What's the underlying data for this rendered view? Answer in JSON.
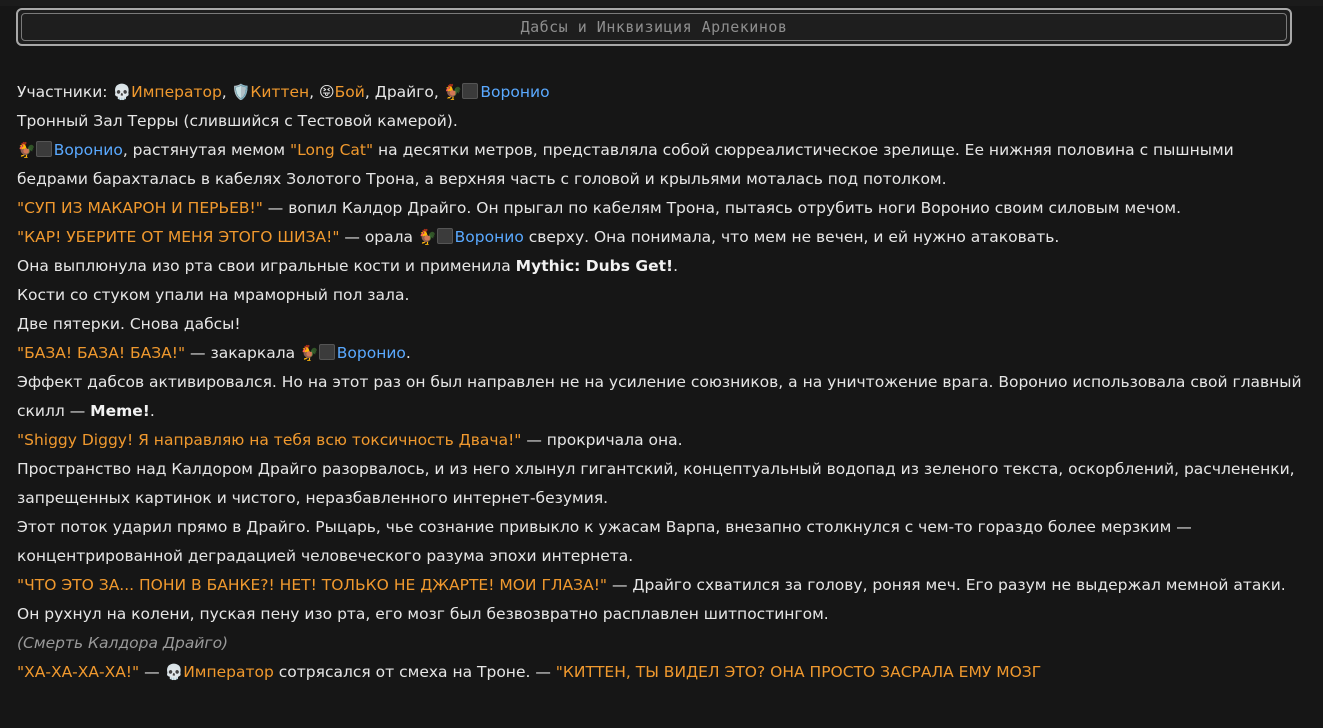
{
  "title": "Дабсы и Инквизиция Арлекинов",
  "icons": {
    "skull": "💀",
    "shield": "🛡️",
    "face": "😝",
    "rooster": "🐓"
  },
  "colors": {
    "background": "#161616",
    "text": "#e6e6e6",
    "speech": "#f0992e",
    "name_blue": "#5aa9ff",
    "name_orange": "#f0992e",
    "narration_gray": "#9a9a9a"
  },
  "participants": {
    "label": "Участники: ",
    "emperor": "Император",
    "kitten": "Киттен",
    "boy": "Бой",
    "draigo": "Драйго",
    "voronio": "Воронио",
    "sep": ", "
  },
  "lines": {
    "l2": "Тронный Зал Терры (слившийся с Тестовой камерой).",
    "l3_name": "Воронио",
    "l3_a": ", растянутая мемом ",
    "l3_quote": "\"Long Cat\"",
    "l3_b": " на десятки метров, представляла собой сюрреалистическое зрелище. Ее нижняя половина с пышными бедрами барахталась в кабелях Золотого Трона, а верхняя часть с головой и крыльями моталась под потолком.",
    "l4_quote": "\"СУП ИЗ МАКАРОН И ПЕРЬЕВ!\"",
    "l4_b": " — вопил Калдор Драйго. Он прыгал по кабелям Трона, пытаясь отрубить ноги Воронио своим силовым мечом.",
    "l5_quote": "\"КАР! УБЕРИТЕ ОТ МЕНЯ ЭТОГО ШИЗА!\"",
    "l5_a": " — орала ",
    "l5_name": "Воронио",
    "l5_b": " сверху. Она понимала, что мем не вечен, и ей нужно атаковать.",
    "l6_a": "Она выплюнула изо рта свои игральные кости и применила ",
    "l6_bold": "Mythic: Dubs Get!",
    "l6_b": ".",
    "l7": "Кости со стуком упали на мраморный пол зала.",
    "l8": "Две пятерки. Снова дабсы!",
    "l9_quote": "\"БАЗА! БАЗА! БАЗА!\"",
    "l9_a": " — закаркала ",
    "l9_name": "Воронио",
    "l9_b": ".",
    "l10_a": "Эффект дабсов активировался. Но на этот раз он был направлен не на усиление союзников, а на уничтожение врага. Воронио использовала свой главный скилл — ",
    "l10_bold": "Meme!",
    "l10_b": ".",
    "l11_quote": "\"Shiggy Diggy! Я направляю на тебя всю токсичность Двача!\"",
    "l11_b": " — прокричала она.",
    "l12": "Пространство над Калдором Драйго разорвалось, и из него хлынул гигантский, концептуальный водопад из зеленого текста, оскорблений, расчлененки, запрещенных картинок и чистого, неразбавленного интернет-безумия.",
    "l13": "Этот поток ударил прямо в Драйго. Рыцарь, чье сознание привыкло к ужасам Варпа, внезапно столкнулся с чем-то гораздо более мерзким — концентрированной деградацией человеческого разума эпохи интернета.",
    "l14_quote": "\"ЧТО ЭТО ЗА... ПОНИ В БАНКЕ?! НЕТ! ТОЛЬКО НЕ ДЖАРТЕ! МОИ ГЛАЗА!\"",
    "l14_b": " — Драйго схватился за голову, роняя меч. Его разум не выдержал мемной атаки. Он рухнул на колени, пуская пену изо рта, его мозг был безвозвратно расплавлен шитпостингом.",
    "l15": "(Смерть Калдора Драйго)",
    "l16_quote": "\"ХА-ХА-ХА-ХА!\"",
    "l16_a": " — ",
    "l16_name": "Император",
    "l16_b": " сотрясался от смеха на Троне. — ",
    "l16_quote2": "\"КИТТЕН, ТЫ ВИДЕЛ ЭТО? ОНА ПРОСТО ЗАСРАЛА ЕМУ МОЗГ"
  }
}
